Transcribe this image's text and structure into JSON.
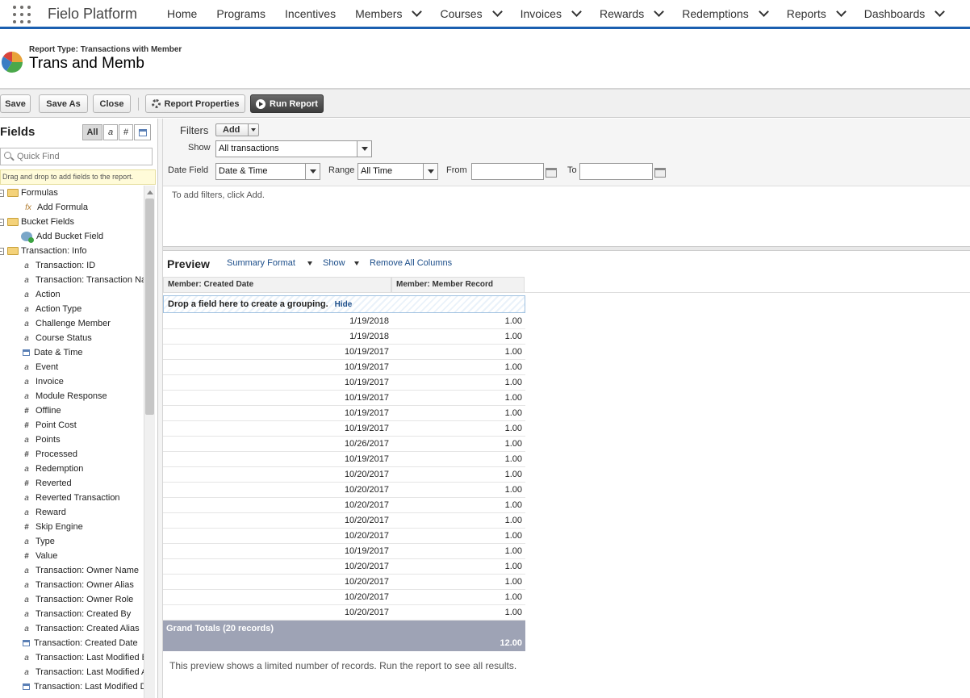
{
  "app": {
    "name": "Fielo Platform"
  },
  "nav": [
    {
      "label": "Home",
      "dropdown": false
    },
    {
      "label": "Programs",
      "dropdown": false
    },
    {
      "label": "Incentives",
      "dropdown": false
    },
    {
      "label": "Members",
      "dropdown": true
    },
    {
      "label": "Courses",
      "dropdown": true
    },
    {
      "label": "Invoices",
      "dropdown": true
    },
    {
      "label": "Rewards",
      "dropdown": true
    },
    {
      "label": "Redemptions",
      "dropdown": true
    },
    {
      "label": "Reports",
      "dropdown": true
    },
    {
      "label": "Dashboards",
      "dropdown": true
    }
  ],
  "report": {
    "type_label": "Report Type: Transactions with Member",
    "title": "Trans and Memb"
  },
  "toolbar": {
    "save": "Save",
    "save_as": "Save As",
    "close": "Close",
    "properties": "Report Properties",
    "run": "Run Report"
  },
  "fields_panel": {
    "title": "Fields",
    "segments": [
      "All",
      "a",
      "#",
      "cal"
    ],
    "search_placeholder": "Quick Find",
    "hint": "Drag and drop to add fields to the report.",
    "tree": [
      {
        "kind": "folder",
        "label": "Formulas"
      },
      {
        "kind": "formula",
        "label": "Add Formula"
      },
      {
        "kind": "folder",
        "label": "Bucket Fields"
      },
      {
        "kind": "bucket",
        "label": "Add Bucket Field"
      },
      {
        "kind": "folder",
        "label": "Transaction: Info"
      },
      {
        "kind": "text",
        "label": "Transaction: ID"
      },
      {
        "kind": "text",
        "label": "Transaction: Transaction Name"
      },
      {
        "kind": "text",
        "label": "Action"
      },
      {
        "kind": "text",
        "label": "Action Type"
      },
      {
        "kind": "text",
        "label": "Challenge Member"
      },
      {
        "kind": "text",
        "label": "Course Status"
      },
      {
        "kind": "date",
        "label": "Date & Time"
      },
      {
        "kind": "text",
        "label": "Event"
      },
      {
        "kind": "text",
        "label": "Invoice"
      },
      {
        "kind": "text",
        "label": "Module Response"
      },
      {
        "kind": "number",
        "label": "Offline"
      },
      {
        "kind": "number",
        "label": "Point Cost"
      },
      {
        "kind": "text",
        "label": "Points"
      },
      {
        "kind": "number",
        "label": "Processed"
      },
      {
        "kind": "text",
        "label": "Redemption"
      },
      {
        "kind": "number",
        "label": "Reverted"
      },
      {
        "kind": "text",
        "label": "Reverted Transaction"
      },
      {
        "kind": "text",
        "label": "Reward"
      },
      {
        "kind": "number",
        "label": "Skip Engine"
      },
      {
        "kind": "text",
        "label": "Type"
      },
      {
        "kind": "number",
        "label": "Value"
      },
      {
        "kind": "text",
        "label": "Transaction: Owner Name"
      },
      {
        "kind": "text",
        "label": "Transaction: Owner Alias"
      },
      {
        "kind": "text",
        "label": "Transaction: Owner Role"
      },
      {
        "kind": "text",
        "label": "Transaction: Created By"
      },
      {
        "kind": "text",
        "label": "Transaction: Created Alias"
      },
      {
        "kind": "date",
        "label": "Transaction: Created Date"
      },
      {
        "kind": "text",
        "label": "Transaction: Last Modified By"
      },
      {
        "kind": "text",
        "label": "Transaction: Last Modified Alias"
      },
      {
        "kind": "date",
        "label": "Transaction: Last Modified Date"
      }
    ]
  },
  "filters": {
    "label": "Filters",
    "add": "Add",
    "show_label": "Show",
    "show_value": "All transactions",
    "date_field_label": "Date Field",
    "date_field_value": "Date & Time",
    "range_label": "Range",
    "range_value": "All Time",
    "from_label": "From",
    "from_value": "",
    "to_label": "To",
    "to_value": "",
    "empty_text": "To add filters, click Add."
  },
  "preview": {
    "title": "Preview",
    "format": "Summary Format",
    "show": "Show",
    "remove": "Remove All Columns",
    "columns": [
      "Member: Created Date",
      "Member: Member Record"
    ],
    "drop_zone": "Drop a field here to create a grouping.",
    "hide": "Hide",
    "rows": [
      {
        "date": "1/19/2018",
        "value": "1.00"
      },
      {
        "date": "1/19/2018",
        "value": "1.00"
      },
      {
        "date": "10/19/2017",
        "value": "1.00"
      },
      {
        "date": "10/19/2017",
        "value": "1.00"
      },
      {
        "date": "10/19/2017",
        "value": "1.00"
      },
      {
        "date": "10/19/2017",
        "value": "1.00"
      },
      {
        "date": "10/19/2017",
        "value": "1.00"
      },
      {
        "date": "10/19/2017",
        "value": "1.00"
      },
      {
        "date": "10/26/2017",
        "value": "1.00"
      },
      {
        "date": "10/19/2017",
        "value": "1.00"
      },
      {
        "date": "10/20/2017",
        "value": "1.00"
      },
      {
        "date": "10/20/2017",
        "value": "1.00"
      },
      {
        "date": "10/20/2017",
        "value": "1.00"
      },
      {
        "date": "10/20/2017",
        "value": "1.00"
      },
      {
        "date": "10/20/2017",
        "value": "1.00"
      },
      {
        "date": "10/19/2017",
        "value": "1.00"
      },
      {
        "date": "10/20/2017",
        "value": "1.00"
      },
      {
        "date": "10/20/2017",
        "value": "1.00"
      },
      {
        "date": "10/20/2017",
        "value": "1.00"
      },
      {
        "date": "10/20/2017",
        "value": "1.00"
      }
    ],
    "grand_label": "Grand Totals (20 records)",
    "grand_value": "12.00",
    "note": "This preview shows a limited number of records. Run the report to see all results."
  }
}
